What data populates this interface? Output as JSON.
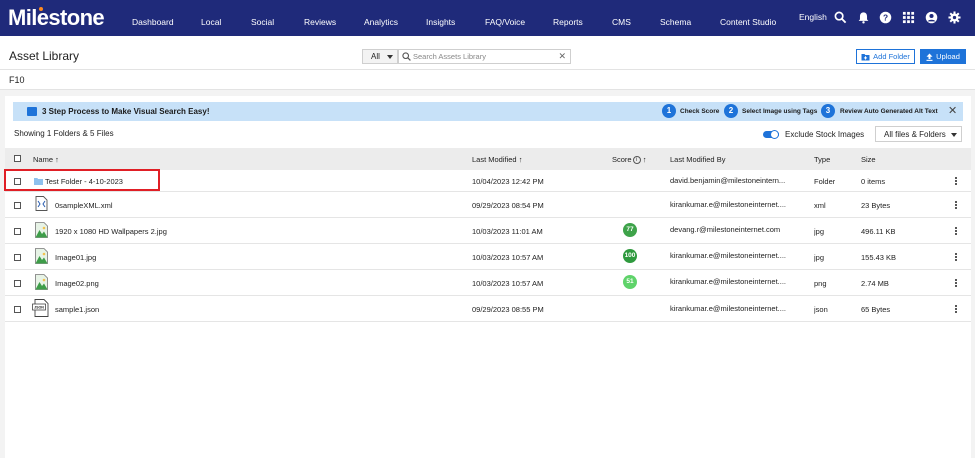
{
  "nav": {
    "logo": "Milestone",
    "items": [
      "Dashboard",
      "Local",
      "Social",
      "Reviews",
      "Analytics",
      "Insights",
      "FAQ/Voice",
      "Reports",
      "CMS",
      "Schema",
      "Content Studio"
    ],
    "language": "English"
  },
  "header": {
    "title": "Asset Library",
    "filter_value": "All",
    "search_placeholder": "Search Assets Library",
    "add_folder_label": "Add Folder",
    "upload_label": "Upload"
  },
  "breadcrumb": "F10",
  "banner": {
    "text": "3 Step Process to Make Visual Search Easy!",
    "steps": [
      {
        "num": "1",
        "label": "Check Score"
      },
      {
        "num": "2",
        "label": "Select Image using Tags"
      },
      {
        "num": "3",
        "label": "Review Auto Generated Alt Text"
      }
    ]
  },
  "toolbar": {
    "showing": "Showing 1 Folders & 5 Files",
    "exclude_label": "Exclude Stock Images",
    "exclude_on": true,
    "files_filter": "All files & Folders"
  },
  "table": {
    "headers": {
      "name": "Name",
      "last_modified": "Last Modified",
      "score": "Score",
      "last_modified_by": "Last Modified By",
      "type": "Type",
      "size": "Size"
    },
    "rows": [
      {
        "name": "Test Folder - 4-10-2023",
        "modified": "10/04/2023 12:42 PM",
        "score": "",
        "by": "david.benjamin@milestoneintern...",
        "type": "Folder",
        "size": "0 items",
        "icon": "folder-icon"
      },
      {
        "name": "0sampleXML.xml",
        "modified": "09/29/2023 08:54 PM",
        "score": "",
        "by": "kirankumar.e@milestoneinternet....",
        "type": "xml",
        "size": "23 Bytes",
        "icon": "xml-file-icon"
      },
      {
        "name": "1920 x 1080 HD Wallpapers 2.jpg",
        "modified": "10/03/2023 11:01 AM",
        "score": "77",
        "by": "devang.r@milestoneinternet.com",
        "type": "jpg",
        "size": "496.11 KB",
        "icon": "image-file-icon"
      },
      {
        "name": "Image01.jpg",
        "modified": "10/03/2023 10:57 AM",
        "score": "100",
        "by": "kirankumar.e@milestoneinternet....",
        "type": "jpg",
        "size": "155.43 KB",
        "icon": "image-file-icon"
      },
      {
        "name": "Image02.png",
        "modified": "10/03/2023 10:57 AM",
        "score": "51",
        "by": "kirankumar.e@milestoneinternet....",
        "type": "png",
        "size": "2.74 MB",
        "icon": "image-file-icon"
      },
      {
        "name": "sample1.json",
        "modified": "09/29/2023 08:55 PM",
        "score": "",
        "by": "kirankumar.e@milestoneinternet....",
        "type": "json",
        "size": "65 Bytes",
        "icon": "json-file-icon"
      }
    ]
  },
  "colors": {
    "nav_bg": "#1f2a7a",
    "accent": "#1e73d9",
    "banner_bg": "#c7e1f8",
    "score_77": "#3ea34a",
    "score_100": "#2f9a3e",
    "score_51": "#5fd36a",
    "highlight": "#e01f26"
  }
}
